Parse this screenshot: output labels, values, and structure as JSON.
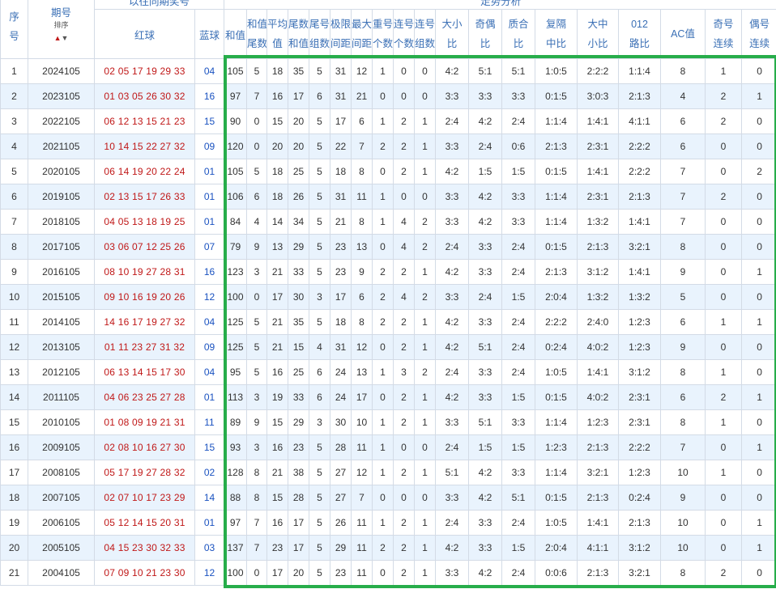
{
  "header": {
    "top_red": "以往同期奖号",
    "top_analysis": "走势分析",
    "seq": [
      "序",
      "号"
    ],
    "issue": "期号",
    "sort_label": "排序",
    "red": "红球",
    "blue": "蓝球",
    "sum_val": "和值",
    "cols": [
      [
        "和值",
        "尾数"
      ],
      [
        "平均",
        "值"
      ],
      [
        "尾数",
        "和值"
      ],
      [
        "尾号",
        "组数"
      ],
      [
        "极限",
        "间距"
      ],
      [
        "最大",
        "间距"
      ],
      [
        "重号",
        "个数"
      ],
      [
        "连号",
        "个数"
      ],
      [
        "连号",
        "组数"
      ],
      [
        "大小",
        "比"
      ],
      [
        "奇偶",
        "比"
      ],
      [
        "质合",
        "比"
      ],
      [
        "复隔",
        "中比"
      ],
      [
        "大中",
        "小比"
      ],
      [
        "012",
        "路比"
      ],
      [
        "AC值",
        ""
      ],
      [
        "奇号",
        "连续"
      ],
      [
        "偶号",
        "连续"
      ]
    ]
  },
  "rows": [
    {
      "seq": "1",
      "issue": "2024105",
      "red": "02 05 17 19 29 33",
      "blue": "04",
      "sum": "105",
      "tail": "5",
      "avg": "18",
      "tailsum": "35",
      "tailgrp": "5",
      "lim": "31",
      "max": "12",
      "rep": "1",
      "cons": "0",
      "consgrp": "0",
      "bs": "4:2",
      "oe": "5:1",
      "pc": "5:1",
      "fgz": "1:0:5",
      "dzx": "2:2:2",
      "r012": "1:1:4",
      "ac": "8",
      "oddc": "1",
      "evenc": "0"
    },
    {
      "seq": "2",
      "issue": "2023105",
      "red": "01 03 05 26 30 32",
      "blue": "16",
      "sum": "97",
      "tail": "7",
      "avg": "16",
      "tailsum": "17",
      "tailgrp": "6",
      "lim": "31",
      "max": "21",
      "rep": "0",
      "cons": "0",
      "consgrp": "0",
      "bs": "3:3",
      "oe": "3:3",
      "pc": "3:3",
      "fgz": "0:1:5",
      "dzx": "3:0:3",
      "r012": "2:1:3",
      "ac": "4",
      "oddc": "2",
      "evenc": "1"
    },
    {
      "seq": "3",
      "issue": "2022105",
      "red": "06 12 13 15 21 23",
      "blue": "15",
      "sum": "90",
      "tail": "0",
      "avg": "15",
      "tailsum": "20",
      "tailgrp": "5",
      "lim": "17",
      "max": "6",
      "rep": "1",
      "cons": "2",
      "consgrp": "1",
      "bs": "2:4",
      "oe": "4:2",
      "pc": "2:4",
      "fgz": "1:1:4",
      "dzx": "1:4:1",
      "r012": "4:1:1",
      "ac": "6",
      "oddc": "2",
      "evenc": "0"
    },
    {
      "seq": "4",
      "issue": "2021105",
      "red": "10 14 15 22 27 32",
      "blue": "09",
      "sum": "120",
      "tail": "0",
      "avg": "20",
      "tailsum": "20",
      "tailgrp": "5",
      "lim": "22",
      "max": "7",
      "rep": "2",
      "cons": "2",
      "consgrp": "1",
      "bs": "3:3",
      "oe": "2:4",
      "pc": "0:6",
      "fgz": "2:1:3",
      "dzx": "2:3:1",
      "r012": "2:2:2",
      "ac": "6",
      "oddc": "0",
      "evenc": "0"
    },
    {
      "seq": "5",
      "issue": "2020105",
      "red": "06 14 19 20 22 24",
      "blue": "01",
      "sum": "105",
      "tail": "5",
      "avg": "18",
      "tailsum": "25",
      "tailgrp": "5",
      "lim": "18",
      "max": "8",
      "rep": "0",
      "cons": "2",
      "consgrp": "1",
      "bs": "4:2",
      "oe": "1:5",
      "pc": "1:5",
      "fgz": "0:1:5",
      "dzx": "1:4:1",
      "r012": "2:2:2",
      "ac": "7",
      "oddc": "0",
      "evenc": "2"
    },
    {
      "seq": "6",
      "issue": "2019105",
      "red": "02 13 15 17 26 33",
      "blue": "01",
      "sum": "106",
      "tail": "6",
      "avg": "18",
      "tailsum": "26",
      "tailgrp": "5",
      "lim": "31",
      "max": "11",
      "rep": "1",
      "cons": "0",
      "consgrp": "0",
      "bs": "3:3",
      "oe": "4:2",
      "pc": "3:3",
      "fgz": "1:1:4",
      "dzx": "2:3:1",
      "r012": "2:1:3",
      "ac": "7",
      "oddc": "2",
      "evenc": "0"
    },
    {
      "seq": "7",
      "issue": "2018105",
      "red": "04 05 13 18 19 25",
      "blue": "01",
      "sum": "84",
      "tail": "4",
      "avg": "14",
      "tailsum": "34",
      "tailgrp": "5",
      "lim": "21",
      "max": "8",
      "rep": "1",
      "cons": "4",
      "consgrp": "2",
      "bs": "3:3",
      "oe": "4:2",
      "pc": "3:3",
      "fgz": "1:1:4",
      "dzx": "1:3:2",
      "r012": "1:4:1",
      "ac": "7",
      "oddc": "0",
      "evenc": "0"
    },
    {
      "seq": "8",
      "issue": "2017105",
      "red": "03 06 07 12 25 26",
      "blue": "07",
      "sum": "79",
      "tail": "9",
      "avg": "13",
      "tailsum": "29",
      "tailgrp": "5",
      "lim": "23",
      "max": "13",
      "rep": "0",
      "cons": "4",
      "consgrp": "2",
      "bs": "2:4",
      "oe": "3:3",
      "pc": "2:4",
      "fgz": "0:1:5",
      "dzx": "2:1:3",
      "r012": "3:2:1",
      "ac": "8",
      "oddc": "0",
      "evenc": "0"
    },
    {
      "seq": "9",
      "issue": "2016105",
      "red": "08 10 19 27 28 31",
      "blue": "16",
      "sum": "123",
      "tail": "3",
      "avg": "21",
      "tailsum": "33",
      "tailgrp": "5",
      "lim": "23",
      "max": "9",
      "rep": "2",
      "cons": "2",
      "consgrp": "1",
      "bs": "4:2",
      "oe": "3:3",
      "pc": "2:4",
      "fgz": "2:1:3",
      "dzx": "3:1:2",
      "r012": "1:4:1",
      "ac": "9",
      "oddc": "0",
      "evenc": "1"
    },
    {
      "seq": "10",
      "issue": "2015105",
      "red": "09 10 16 19 20 26",
      "blue": "12",
      "sum": "100",
      "tail": "0",
      "avg": "17",
      "tailsum": "30",
      "tailgrp": "3",
      "lim": "17",
      "max": "6",
      "rep": "2",
      "cons": "4",
      "consgrp": "2",
      "bs": "3:3",
      "oe": "2:4",
      "pc": "1:5",
      "fgz": "2:0:4",
      "dzx": "1:3:2",
      "r012": "1:3:2",
      "ac": "5",
      "oddc": "0",
      "evenc": "0"
    },
    {
      "seq": "11",
      "issue": "2014105",
      "red": "14 16 17 19 27 32",
      "blue": "04",
      "sum": "125",
      "tail": "5",
      "avg": "21",
      "tailsum": "35",
      "tailgrp": "5",
      "lim": "18",
      "max": "8",
      "rep": "2",
      "cons": "2",
      "consgrp": "1",
      "bs": "4:2",
      "oe": "3:3",
      "pc": "2:4",
      "fgz": "2:2:2",
      "dzx": "2:4:0",
      "r012": "1:2:3",
      "ac": "6",
      "oddc": "1",
      "evenc": "1"
    },
    {
      "seq": "12",
      "issue": "2013105",
      "red": "01 11 23 27 31 32",
      "blue": "09",
      "sum": "125",
      "tail": "5",
      "avg": "21",
      "tailsum": "15",
      "tailgrp": "4",
      "lim": "31",
      "max": "12",
      "rep": "0",
      "cons": "2",
      "consgrp": "1",
      "bs": "4:2",
      "oe": "5:1",
      "pc": "2:4",
      "fgz": "0:2:4",
      "dzx": "4:0:2",
      "r012": "1:2:3",
      "ac": "9",
      "oddc": "0",
      "evenc": "0"
    },
    {
      "seq": "13",
      "issue": "2012105",
      "red": "06 13 14 15 17 30",
      "blue": "04",
      "sum": "95",
      "tail": "5",
      "avg": "16",
      "tailsum": "25",
      "tailgrp": "6",
      "lim": "24",
      "max": "13",
      "rep": "1",
      "cons": "3",
      "consgrp": "2",
      "bs": "2:4",
      "oe": "3:3",
      "pc": "2:4",
      "fgz": "1:0:5",
      "dzx": "1:4:1",
      "r012": "3:1:2",
      "ac": "8",
      "oddc": "1",
      "evenc": "0"
    },
    {
      "seq": "14",
      "issue": "2011105",
      "red": "04 06 23 25 27 28",
      "blue": "01",
      "sum": "113",
      "tail": "3",
      "avg": "19",
      "tailsum": "33",
      "tailgrp": "6",
      "lim": "24",
      "max": "17",
      "rep": "0",
      "cons": "2",
      "consgrp": "1",
      "bs": "4:2",
      "oe": "3:3",
      "pc": "1:5",
      "fgz": "0:1:5",
      "dzx": "4:0:2",
      "r012": "2:3:1",
      "ac": "6",
      "oddc": "2",
      "evenc": "1"
    },
    {
      "seq": "15",
      "issue": "2010105",
      "red": "01 08 09 19 21 31",
      "blue": "11",
      "sum": "89",
      "tail": "9",
      "avg": "15",
      "tailsum": "29",
      "tailgrp": "3",
      "lim": "30",
      "max": "10",
      "rep": "1",
      "cons": "2",
      "consgrp": "1",
      "bs": "3:3",
      "oe": "5:1",
      "pc": "3:3",
      "fgz": "1:1:4",
      "dzx": "1:2:3",
      "r012": "2:3:1",
      "ac": "8",
      "oddc": "1",
      "evenc": "0"
    },
    {
      "seq": "16",
      "issue": "2009105",
      "red": "02 08 10 16 27 30",
      "blue": "15",
      "sum": "93",
      "tail": "3",
      "avg": "16",
      "tailsum": "23",
      "tailgrp": "5",
      "lim": "28",
      "max": "11",
      "rep": "1",
      "cons": "0",
      "consgrp": "0",
      "bs": "2:4",
      "oe": "1:5",
      "pc": "1:5",
      "fgz": "1:2:3",
      "dzx": "2:1:3",
      "r012": "2:2:2",
      "ac": "7",
      "oddc": "0",
      "evenc": "1"
    },
    {
      "seq": "17",
      "issue": "2008105",
      "red": "05 17 19 27 28 32",
      "blue": "02",
      "sum": "128",
      "tail": "8",
      "avg": "21",
      "tailsum": "38",
      "tailgrp": "5",
      "lim": "27",
      "max": "12",
      "rep": "1",
      "cons": "2",
      "consgrp": "1",
      "bs": "5:1",
      "oe": "4:2",
      "pc": "3:3",
      "fgz": "1:1:4",
      "dzx": "3:2:1",
      "r012": "1:2:3",
      "ac": "10",
      "oddc": "1",
      "evenc": "0"
    },
    {
      "seq": "18",
      "issue": "2007105",
      "red": "02 07 10 17 23 29",
      "blue": "14",
      "sum": "88",
      "tail": "8",
      "avg": "15",
      "tailsum": "28",
      "tailgrp": "5",
      "lim": "27",
      "max": "7",
      "rep": "0",
      "cons": "0",
      "consgrp": "0",
      "bs": "3:3",
      "oe": "4:2",
      "pc": "5:1",
      "fgz": "0:1:5",
      "dzx": "2:1:3",
      "r012": "0:2:4",
      "ac": "9",
      "oddc": "0",
      "evenc": "0"
    },
    {
      "seq": "19",
      "issue": "2006105",
      "red": "05 12 14 15 20 31",
      "blue": "01",
      "sum": "97",
      "tail": "7",
      "avg": "16",
      "tailsum": "17",
      "tailgrp": "5",
      "lim": "26",
      "max": "11",
      "rep": "1",
      "cons": "2",
      "consgrp": "1",
      "bs": "2:4",
      "oe": "3:3",
      "pc": "2:4",
      "fgz": "1:0:5",
      "dzx": "1:4:1",
      "r012": "2:1:3",
      "ac": "10",
      "oddc": "0",
      "evenc": "1"
    },
    {
      "seq": "20",
      "issue": "2005105",
      "red": "04 15 23 30 32 33",
      "blue": "03",
      "sum": "137",
      "tail": "7",
      "avg": "23",
      "tailsum": "17",
      "tailgrp": "5",
      "lim": "29",
      "max": "11",
      "rep": "2",
      "cons": "2",
      "consgrp": "1",
      "bs": "4:2",
      "oe": "3:3",
      "pc": "1:5",
      "fgz": "2:0:4",
      "dzx": "4:1:1",
      "r012": "3:1:2",
      "ac": "10",
      "oddc": "0",
      "evenc": "1"
    },
    {
      "seq": "21",
      "issue": "2004105",
      "red": "07 09 10 21 23 30",
      "blue": "12",
      "sum": "100",
      "tail": "0",
      "avg": "17",
      "tailsum": "20",
      "tailgrp": "5",
      "lim": "23",
      "max": "11",
      "rep": "0",
      "cons": "2",
      "consgrp": "1",
      "bs": "3:3",
      "oe": "4:2",
      "pc": "2:4",
      "fgz": "0:0:6",
      "dzx": "2:1:3",
      "r012": "3:2:1",
      "ac": "8",
      "oddc": "2",
      "evenc": "0"
    }
  ],
  "colors": {
    "red_ball": "#c01818",
    "blue_ball": "#1a52c0",
    "header_text": "#3a6fb5",
    "row_alt": "#e9f3fd",
    "highlight_frame": "#27ad4a"
  }
}
